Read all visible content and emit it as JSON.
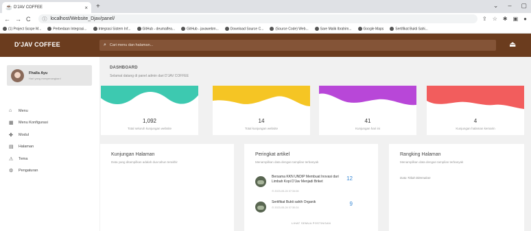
{
  "browser": {
    "tab_title": "D'JAV COFFEE",
    "url": "localhost/Website_Djav/panel/",
    "bookmarks": [
      "(1) Project Scope M...",
      "Perbedaan Integrasi...",
      "Integrasi Sistem Inf...",
      "GitHub - deumalfea...",
      "GitHub - javawebm...",
      "Download Source C...",
      "(Source Code) Web...",
      "Sare Malik Ibrahim...",
      "Google Maps",
      "Sertifikat Bukti Sahi..."
    ]
  },
  "header": {
    "brand": "D'JAV COFFEE",
    "search_placeholder": "Cari menu dan halaman..."
  },
  "sidebar": {
    "profile_name": "Fhalla Ayu",
    "profile_role": "Hari yang menyenangkan!",
    "items": [
      {
        "label": "Menu",
        "icon": "home-icon"
      },
      {
        "label": "Menu Konfigurasi",
        "icon": "grid-icon"
      },
      {
        "label": "Modul",
        "icon": "puzzle-icon"
      },
      {
        "label": "Halaman",
        "icon": "page-icon"
      },
      {
        "label": "Tema",
        "icon": "theme-icon"
      },
      {
        "label": "Pengaturan",
        "icon": "gear-icon"
      }
    ]
  },
  "page": {
    "breadcrumb": "DASHBOARD",
    "subtitle": "Selamat datang di panel admin dari D'JAV COFFEE"
  },
  "stats": [
    {
      "value": "1,092",
      "label": "Total seluruh kunjungan website",
      "color": "#3dc9b0"
    },
    {
      "value": "14",
      "label": "Total kunjungan website",
      "color": "#f5c524"
    },
    {
      "value": "41",
      "label": "Kunjungan hari ini",
      "color": "#b847d8"
    },
    {
      "value": "4",
      "label": "Kunjungan halaman kemarin",
      "color": "#f25d5d"
    }
  ],
  "panels": {
    "visits": {
      "title": "Kunjungan Halaman",
      "desc": "Data yang ditampilkan adalah dua tahun terakhir"
    },
    "articles": {
      "title": "Peringkat artikel",
      "desc": "Menampilkan data dengan tampilan terbanyak",
      "items": [
        {
          "title": "Bersama KKN UNDIP Membuat Inovasi dari Limbah Kopi D'Jav Menjadi Briket",
          "date": "2023-05-24 07:34:06",
          "count": "12"
        },
        {
          "title": "Sertifikat Bukti sahih Organik",
          "date": "2023-05-24 07:30:24",
          "count": "9"
        }
      ],
      "all_link": "LIHAT SEMUA POSTINGAN"
    },
    "ranking": {
      "title": "Rangking Halaman",
      "desc": "Menampilkan data dengan tampilan terbanyak",
      "empty": "Data Tidak Ditemukan"
    }
  }
}
